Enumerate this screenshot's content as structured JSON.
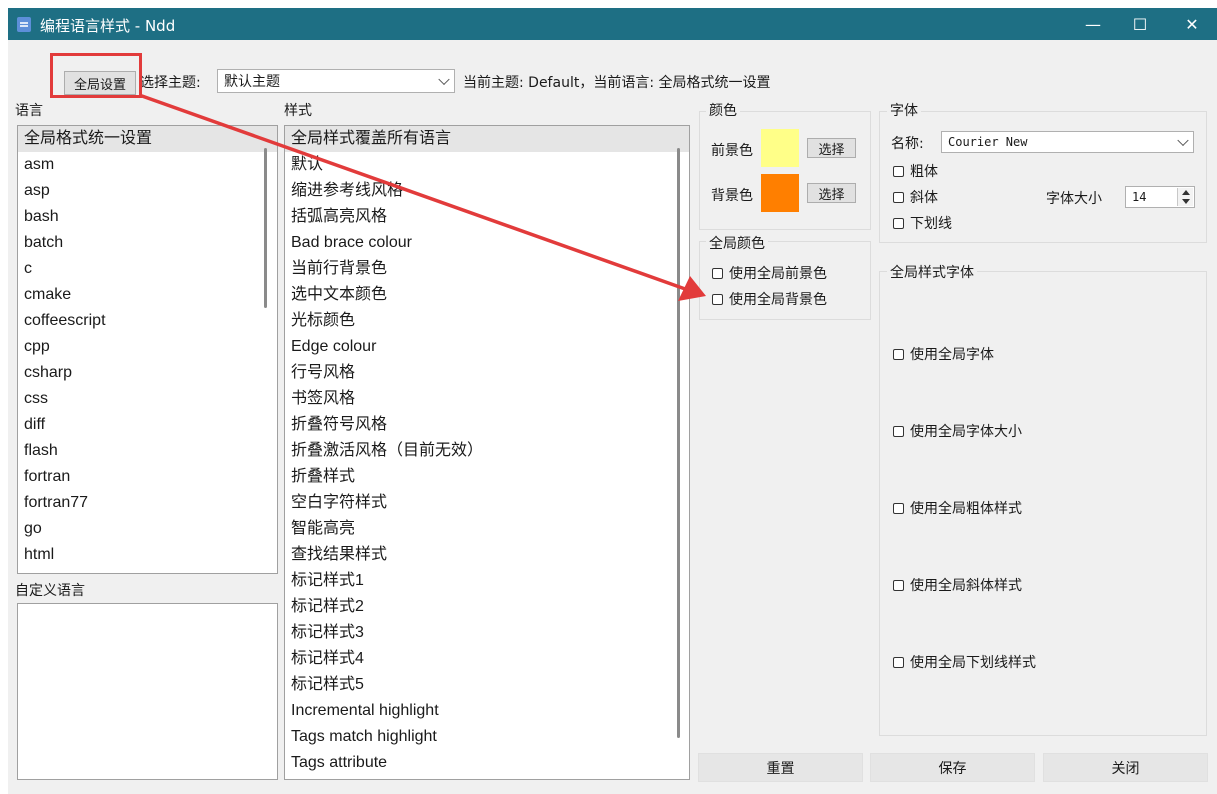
{
  "window": {
    "title": "编程语言样式 - Ndd",
    "minimize_glyph": "—",
    "maximize_glyph": "☐",
    "close_glyph": "✕"
  },
  "toolbar": {
    "global_settings_label": "全局设置",
    "select_theme_label": "选择主题:",
    "theme_value": "默认主题",
    "status_text": "当前主题: Default，当前语言: 全局格式统一设置"
  },
  "language_panel": {
    "label": "语言",
    "items": [
      "全局格式统一设置",
      "asm",
      "asp",
      "bash",
      "batch",
      "c",
      "cmake",
      "coffeescript",
      "cpp",
      "csharp",
      "css",
      "diff",
      "flash",
      "fortran",
      "fortran77",
      "go",
      "html"
    ],
    "selected_index": 0,
    "custom_label": "自定义语言"
  },
  "style_panel": {
    "label": "样式",
    "items": [
      "全局样式覆盖所有语言",
      "默认",
      "缩进参考线风格",
      "括弧高亮风格",
      "Bad brace colour",
      "当前行背景色",
      "选中文本颜色",
      "光标颜色",
      "Edge colour",
      "行号风格",
      "书签风格",
      "折叠符号风格",
      "折叠激活风格（目前无效）",
      "折叠样式",
      "空白字符样式",
      "智能高亮",
      "查找结果样式",
      "标记样式1",
      "标记样式2",
      "标记样式3",
      "标记样式4",
      "标记样式5",
      "Incremental highlight",
      "Tags match highlight",
      "Tags attribute"
    ],
    "selected_index": 0
  },
  "color_group": {
    "title": "颜色",
    "fg_label": "前景色",
    "fg_color": "#ffff88",
    "bg_label": "背景色",
    "bg_color": "#ff7f00",
    "choose_label": "选择"
  },
  "global_color_group": {
    "title": "全局颜色",
    "use_global_fg": "使用全局前景色",
    "use_global_bg": "使用全局背景色"
  },
  "font_group": {
    "title": "字体",
    "name_label": "名称:",
    "font_value": "Courier New",
    "bold_label": "粗体",
    "italic_label": "斜体",
    "underline_label": "下划线",
    "size_label": "字体大小",
    "size_value": "14"
  },
  "global_font_group": {
    "title": "全局样式字体",
    "use_global_font": "使用全局字体",
    "use_global_font_size": "使用全局字体大小",
    "use_global_bold": "使用全局粗体样式",
    "use_global_italic": "使用全局斜体样式",
    "use_global_underline": "使用全局下划线样式"
  },
  "footer": {
    "reset_label": "重置",
    "save_label": "保存",
    "close_label": "关闭"
  },
  "annotation_color": "#e23b3b"
}
